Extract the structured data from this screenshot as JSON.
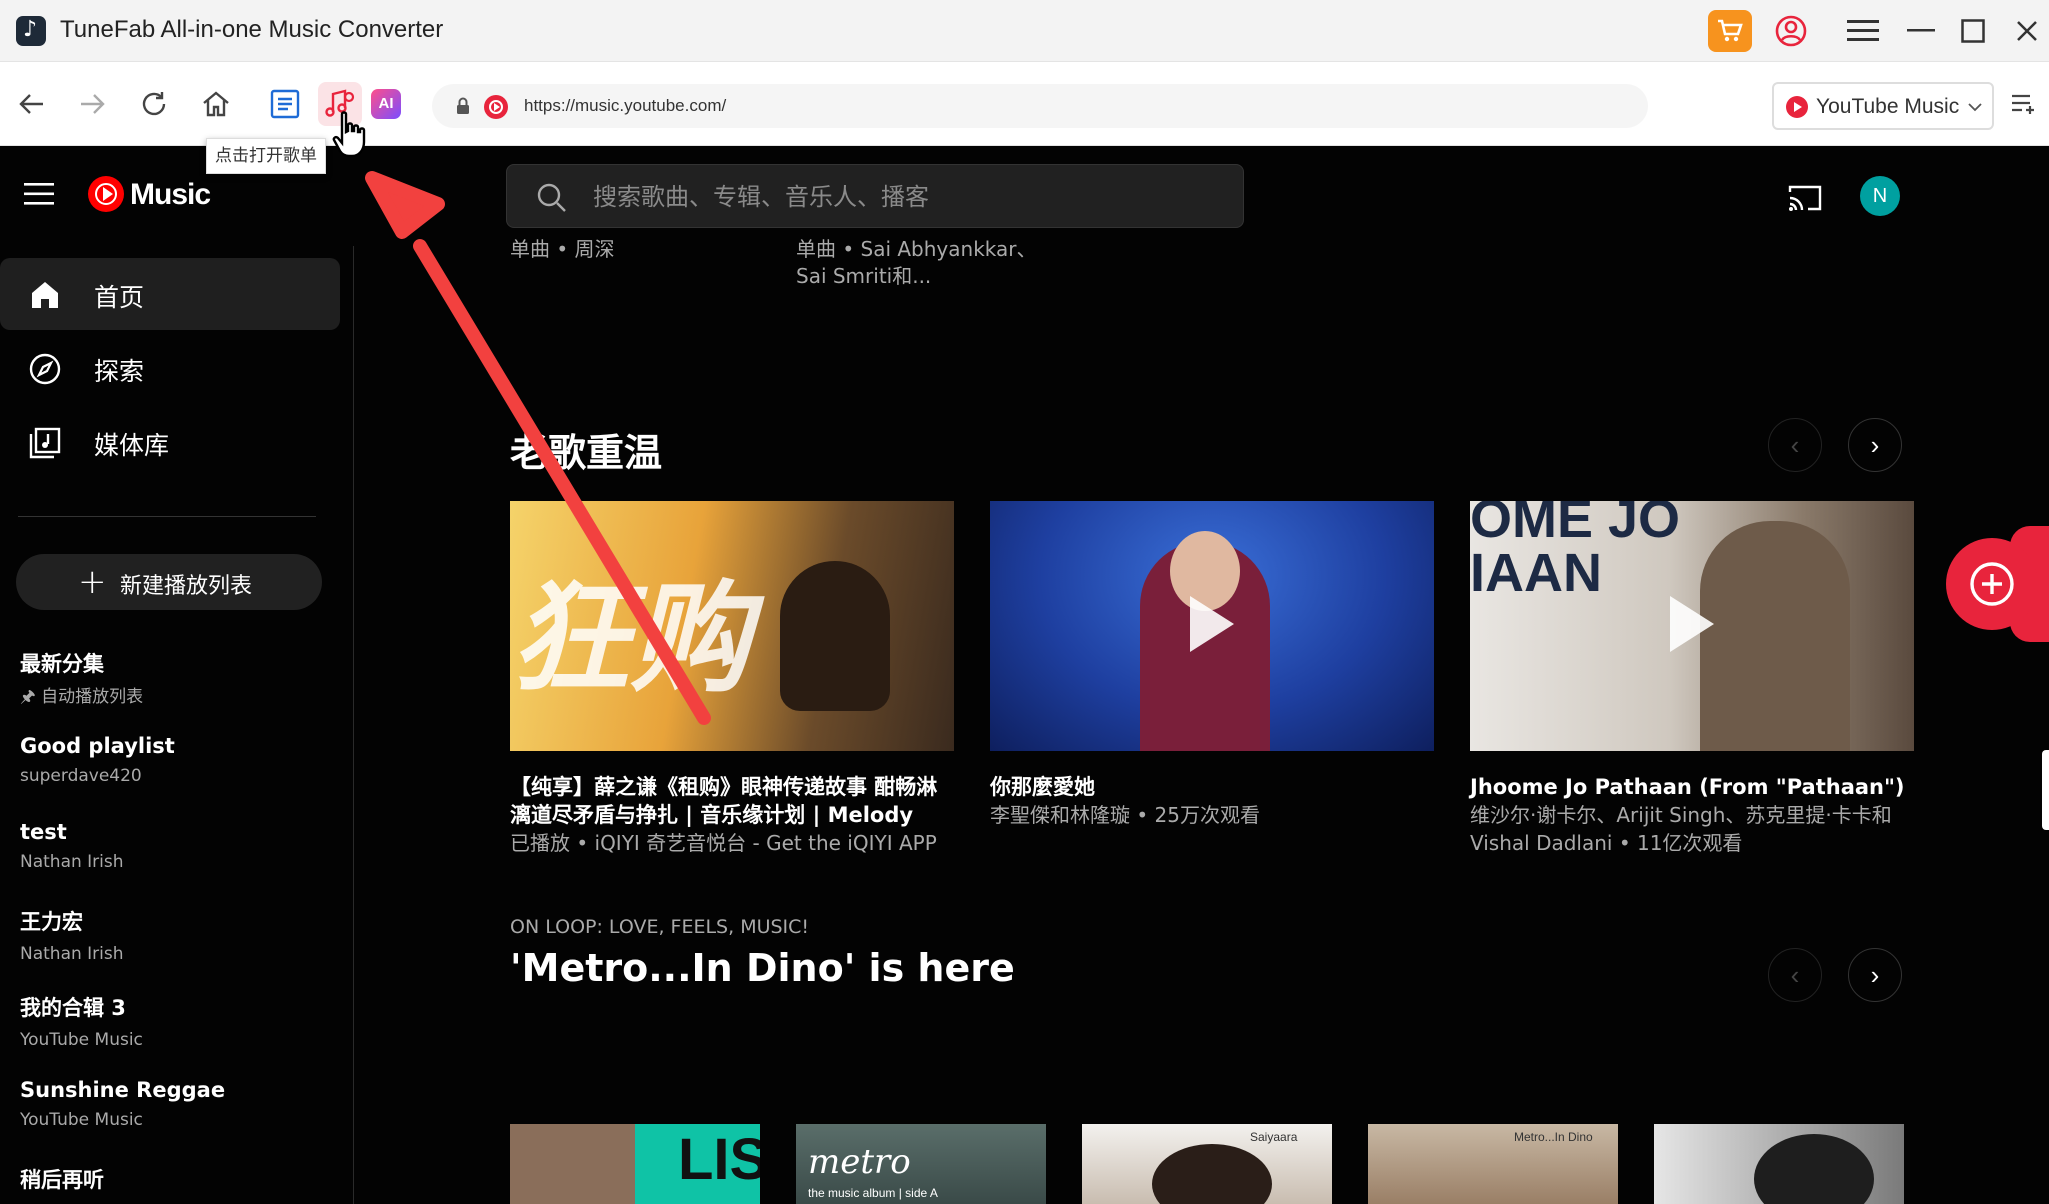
{
  "window": {
    "title": "TuneFab All-in-one Music Converter"
  },
  "toolbar": {
    "url": "https://music.youtube.com/",
    "source_selected": "YouTube Music",
    "tooltip": "点击打开歌单",
    "ai_label": "AI"
  },
  "ytm": {
    "logo_text": "Music",
    "search_placeholder": "搜索歌曲、专辑、音乐人、播客",
    "avatar_letter": "N",
    "nav": [
      {
        "label": "首页",
        "icon": "home-icon"
      },
      {
        "label": "探索",
        "icon": "compass-icon"
      },
      {
        "label": "媒体库",
        "icon": "library-icon"
      }
    ],
    "new_playlist_label": "新建播放列表",
    "playlists": [
      {
        "title": "最新分集",
        "subtitle": "自动播放列表"
      },
      {
        "title": "Good playlist",
        "subtitle": "superdave420"
      },
      {
        "title": "test",
        "subtitle": "Nathan Irish"
      },
      {
        "title": "王力宏",
        "subtitle": "Nathan Irish"
      },
      {
        "title": "我的合辑 3",
        "subtitle": "YouTube Music"
      },
      {
        "title": "Sunshine Reggae",
        "subtitle": "YouTube Music"
      },
      {
        "title": "稍后再听",
        "subtitle": ""
      }
    ],
    "top_items": [
      {
        "line1": "单曲 • 周深",
        "line2": ""
      },
      {
        "line1": "单曲 • Sai Abhyankkar、",
        "line2": "Sai Smriti和..."
      }
    ],
    "section1": {
      "title": "老歌重温",
      "cards": [
        {
          "title_line1": "【纯享】薛之谦《租购》眼神传递故事 酣畅淋",
          "title_line2": "漓道尽矛盾与挣扎 | 音乐缘计划 | Melody",
          "subtitle_line1": "已播放 • iQIYI 奇艺音悦台 - Get the iQIYI APP",
          "subtitle_line2": ""
        },
        {
          "title_line1": "你那麼愛她",
          "title_line2": "",
          "subtitle_line1": "李聖傑和林隆璇 • 25万次观看",
          "subtitle_line2": ""
        },
        {
          "title_line1": "Jhoome Jo Pathaan (From \"Pathaan\")",
          "title_line2": "",
          "subtitle_line1": "维沙尔·谢卡尔、Arijit Singh、苏克里提·卡卡和",
          "subtitle_line2": "Vishal Dadlani • 11亿次观看"
        }
      ],
      "thumb_texts": [
        "狂购",
        "OME JO",
        "IAAN"
      ]
    },
    "section2": {
      "kicker": "ON LOOP: LOVE, FEELS, MUSIC!",
      "title": "'Metro...In Dino' is here",
      "album_texts": [
        "LIST",
        "metro",
        "the music album | side A",
        "Saiyaara",
        "Metro...In Dino"
      ]
    }
  },
  "colors": {
    "accent_red": "#e8243c",
    "cart_orange": "#f7931e",
    "ytm_bg": "#030303",
    "avatar_teal": "#00a0a0"
  }
}
